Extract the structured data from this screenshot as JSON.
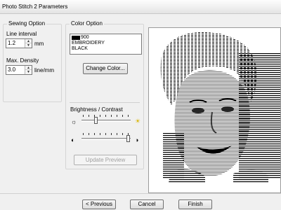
{
  "window": {
    "title": "Photo Stitch 2 Parameters"
  },
  "sewing_option": {
    "title": "Sewing Option",
    "line_interval_label": "Line interval",
    "line_interval_value": "1.2",
    "line_interval_unit": "mm",
    "max_density_label": "Max. Density",
    "max_density_value": "3.0",
    "max_density_unit": "line/mm"
  },
  "color_option": {
    "title": "Color Option",
    "color_code": "900",
    "color_line1": "EMBROIDERY",
    "color_line2": "BLACK",
    "swatch_color": "#000000",
    "change_color_label": "Change Color..."
  },
  "brightness_contrast": {
    "label": "Brightness / Contrast",
    "brightness_level": 0.28,
    "contrast_level": 1.0,
    "brightness_low_icon": "sun-small-icon",
    "brightness_high_icon": "sun-large-icon",
    "contrast_low_icon": "contrast-low-icon",
    "contrast_high_icon": "contrast-high-icon"
  },
  "update_preview_label": "Update Preview",
  "footer": {
    "previous_label": "< Previous",
    "cancel_label": "Cancel",
    "finish_label": "Finish"
  }
}
